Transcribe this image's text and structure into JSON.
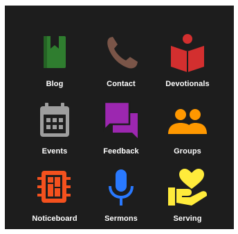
{
  "menu": {
    "items": [
      {
        "label": "Blog",
        "icon": "book-icon",
        "color": "#2f7d2f"
      },
      {
        "label": "Contact",
        "icon": "phone-icon",
        "color": "#7a5548"
      },
      {
        "label": "Devotionals",
        "icon": "reader-icon",
        "color": "#d32f2f"
      },
      {
        "label": "Events",
        "icon": "calendar-icon",
        "color": "#9e9e9e"
      },
      {
        "label": "Feedback",
        "icon": "chat-icon",
        "color": "#9c27b0"
      },
      {
        "label": "Groups",
        "icon": "people-icon",
        "color": "#ff9800"
      },
      {
        "label": "Noticeboard",
        "icon": "noticeboard-icon",
        "color": "#f4511e"
      },
      {
        "label": "Sermons",
        "icon": "microphone-icon",
        "color": "#2979ff"
      },
      {
        "label": "Serving",
        "icon": "hand-heart-icon",
        "color": "#ffeb3b"
      }
    ]
  }
}
